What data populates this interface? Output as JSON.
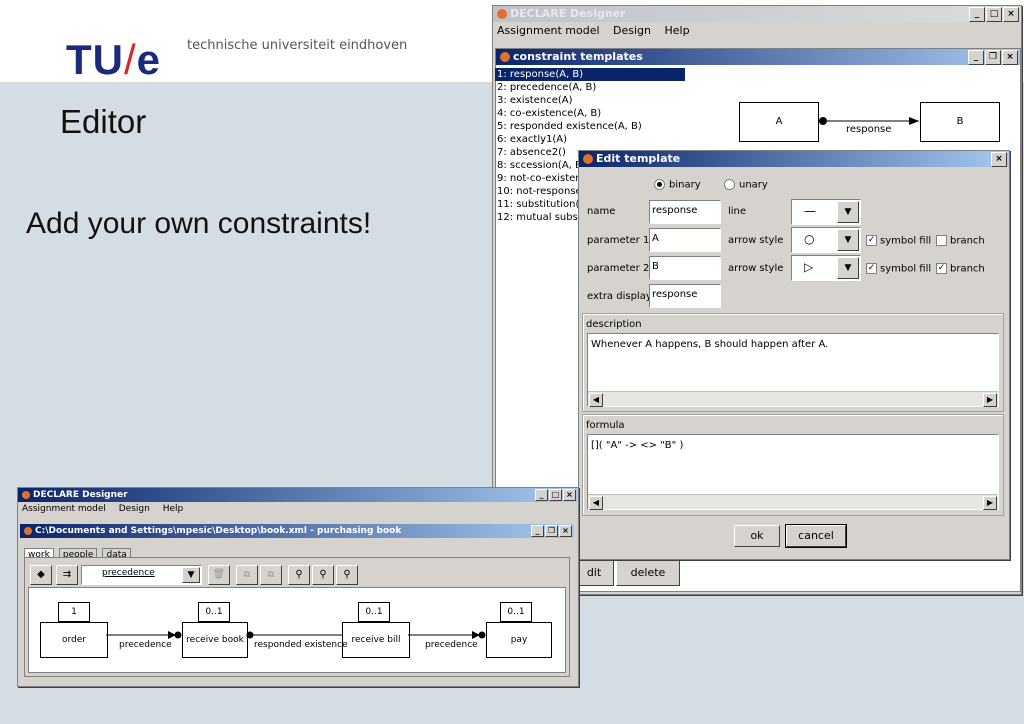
{
  "slide": {
    "logo_main": "TU",
    "logo_slash": "/",
    "logo_e": "e",
    "institution": "technische universiteit eindhoven",
    "title": "Editor",
    "body": "Add your own constraints!"
  },
  "main_window": {
    "title": "DECLARE Designer",
    "menu": [
      "Assignment model",
      "Design",
      "Help"
    ],
    "inner_title": "constraint templates",
    "templates": [
      "1: response(A, B)",
      "2: precedence(A, B)",
      "3: existence(A)",
      "4: co-existence(A, B)",
      "5: responded existence(A, B)",
      "6: exactly1(A)",
      "7: absence2()",
      "8: sccession(A, E",
      "9: not-co-exister",
      "10: not-response",
      "11: substitution(",
      "12: mutual subst"
    ],
    "diagram": {
      "box_a": "A",
      "box_b": "B",
      "connector_label": "response"
    },
    "bottom_buttons": {
      "edit": "dit",
      "delete": "delete"
    }
  },
  "edit_template": {
    "title": "Edit template",
    "radio_binary": "binary",
    "radio_unary": "unary",
    "selected_type": "binary",
    "name_label": "name",
    "name_value": "response",
    "line_label": "line",
    "line_value": "—",
    "param1_label": "parameter 1",
    "param1_value": "A",
    "param2_label": "parameter 2",
    "param2_value": "B",
    "arrow_style_label": "arrow style",
    "arrow1_value": "○",
    "arrow2_value": "▷",
    "symbol_fill_label": "symbol fill",
    "branch_label": "branch",
    "row1_symbol_fill": true,
    "row1_branch": false,
    "row2_symbol_fill": true,
    "row2_branch": true,
    "extra_display_label": "extra display",
    "extra_display_value": "response",
    "description_label": "description",
    "description_text": "Whenever A happens, B should happen after A.",
    "formula_label": "formula",
    "formula_text": "[]( \"A\" -> <> \"B\" )",
    "ok_label": "ok",
    "cancel_label": "cancel"
  },
  "small_window": {
    "title": "DECLARE Designer",
    "menu": [
      "Assignment model",
      "Design",
      "Help"
    ],
    "inner_title": "C:\\Documents and Settings\\mpesic\\Desktop\\book.xml - purchasing book",
    "tabs": [
      "work",
      "people",
      "data"
    ],
    "combo_value": "precedence",
    "nodes": [
      {
        "label": "order",
        "card": "1"
      },
      {
        "label": "receive book",
        "card": "0..1"
      },
      {
        "label": "receive bill",
        "card": "0..1"
      },
      {
        "label": "pay",
        "card": "0..1"
      }
    ],
    "edges": [
      "precedence",
      "responded existence",
      "precedence"
    ]
  }
}
